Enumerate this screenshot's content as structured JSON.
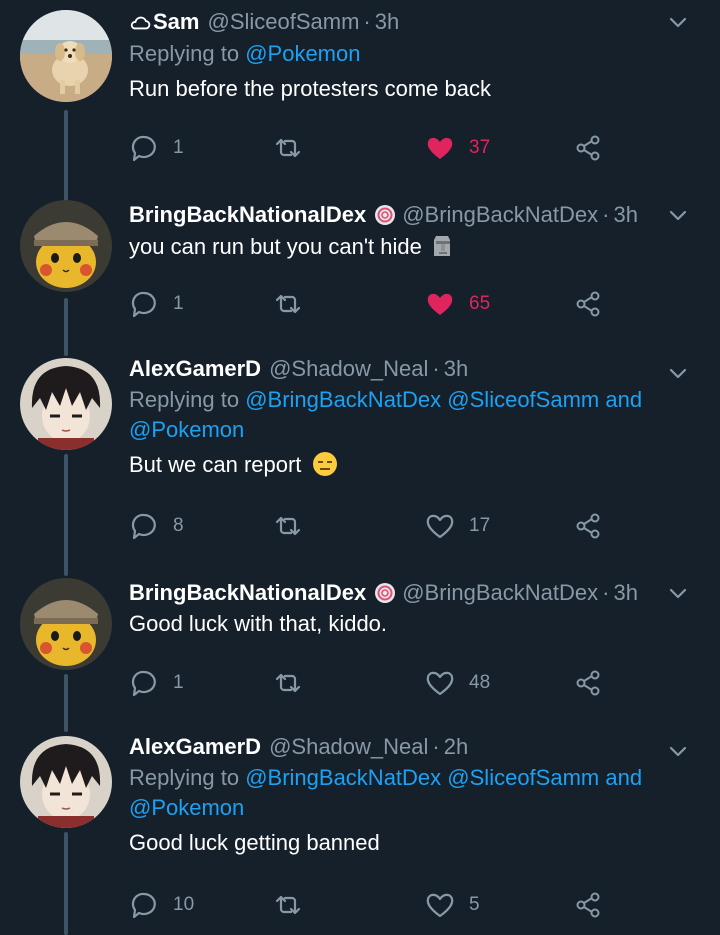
{
  "colors": {
    "background": "#15202b",
    "secondary_text": "#8899a6",
    "link": "#1da1f2",
    "like_active": "#e0245e",
    "thread_line": "#3d5466"
  },
  "tweets": [
    {
      "display_name": "Sam",
      "name_icon": "cloud-outline-icon",
      "handle": "@SliceofSamm",
      "separator": "·",
      "time": "3h",
      "replying_prefix": "Replying to",
      "replying_mentions": [
        "@Pokemon"
      ],
      "replying_and": "",
      "replying_last": "",
      "text": "Run before the protesters come back",
      "text_emoji": "",
      "replies": "1",
      "retweets": "",
      "likes": "37",
      "liked": true
    },
    {
      "display_name": "BringBackNationalDex",
      "name_icon": "swirl-badge-icon",
      "handle": "@BringBackNatDex",
      "separator": "·",
      "time": "3h",
      "text": "you can run but you can't hide",
      "text_emoji": "moai-icon",
      "replies": "1",
      "retweets": "",
      "likes": "65",
      "liked": true
    },
    {
      "display_name": "AlexGamerD",
      "handle": "@Shadow_Neal",
      "separator": "·",
      "time": "3h",
      "replying_prefix": "Replying to",
      "replying_mentions": [
        "@BringBackNatDex",
        "@SliceofSamm"
      ],
      "replying_and": "and",
      "replying_last": "@Pokemon",
      "text": "But we can report",
      "text_emoji": "expressionless-face-icon",
      "replies": "8",
      "retweets": "",
      "likes": "17",
      "liked": false
    },
    {
      "display_name": "BringBackNationalDex",
      "name_icon": "swirl-badge-icon",
      "handle": "@BringBackNatDex",
      "separator": "·",
      "time": "3h",
      "text": "Good luck with that, kiddo.",
      "replies": "1",
      "retweets": "",
      "likes": "48",
      "liked": false
    },
    {
      "display_name": "AlexGamerD",
      "handle": "@Shadow_Neal",
      "separator": "·",
      "time": "2h",
      "replying_prefix": "Replying to",
      "replying_mentions": [
        "@BringBackNatDex",
        "@SliceofSamm"
      ],
      "replying_and": "and",
      "replying_last": "@Pokemon",
      "text": "Good luck getting banned",
      "replies": "10",
      "retweets": "",
      "likes": "5",
      "liked": false
    }
  ]
}
